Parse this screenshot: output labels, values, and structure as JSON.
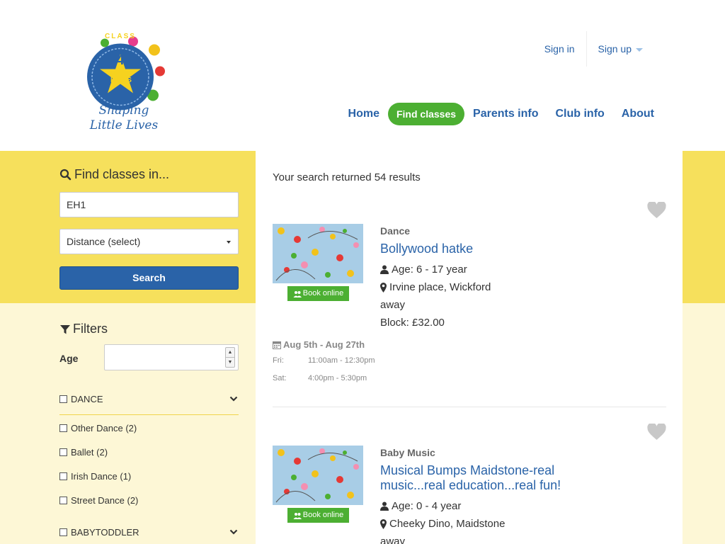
{
  "header": {
    "logo_text_top": "CLASS",
    "logo_number": "4",
    "logo_text_bottom": "KIDS",
    "tagline_line1": "Shaping",
    "tagline_line2": "Little Lives",
    "sign_in": "Sign in",
    "sign_up": "Sign up",
    "nav": [
      "Home",
      "Find classes",
      "Parents info",
      "Club info",
      "About"
    ],
    "active_nav": "Find classes"
  },
  "sidebar": {
    "search_title": "Find classes in...",
    "location_value": "EH1",
    "distance_value": "Distance (select)",
    "search_button": "Search",
    "filters_title": "Filters",
    "age_label": "Age",
    "categories": [
      {
        "label": "DANCE",
        "subitems": [
          "Other Dance (2)",
          "Ballet (2)",
          "Irish Dance (1)",
          "Street Dance (2)"
        ]
      },
      {
        "label": "BABYTODDLER",
        "subitems": []
      }
    ]
  },
  "results": {
    "count_text": "Your search returned 54 results",
    "items": [
      {
        "category": "Dance",
        "title": "Bollywood hatke",
        "age": "Age: 6 - 17 year",
        "location": "Irvine place, Wickford",
        "away": "away",
        "price": "Block: £32.00",
        "book_label": "Book online",
        "dates": "Aug 5th - Aug 27th",
        "schedule": [
          {
            "day": "Fri:",
            "time": "11:00am - 12:30pm"
          },
          {
            "day": "Sat:",
            "time": "4:00pm - 5:30pm"
          }
        ]
      },
      {
        "category": "Baby Music",
        "title": "Musical Bumps Maidstone-real music...real education...real fun!",
        "age": "Age: 0 - 4 year",
        "location": "Cheeky Dino, Maidstone",
        "away": "away",
        "book_label": "Book online"
      }
    ]
  },
  "colors": {
    "brand_blue": "#2a63a8",
    "brand_green": "#4caf32",
    "band_yellow": "#f6e05c",
    "band_light": "#fdf7d6"
  }
}
